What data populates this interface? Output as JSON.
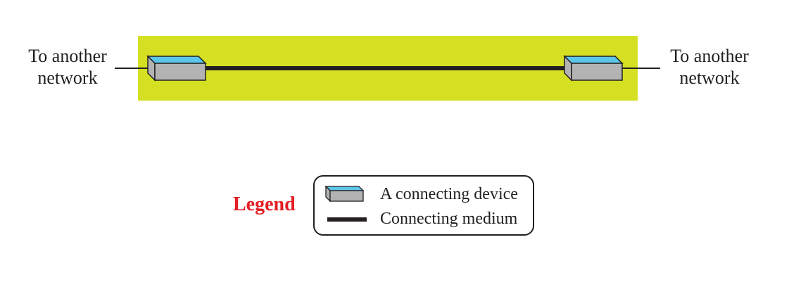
{
  "colors": {
    "network_area": "#d4e021",
    "device_top": "#5cc6ea",
    "device_body": "#b3b3b3",
    "medium": "#231f20",
    "text": "#231f20",
    "legend_title": "#e31e24"
  },
  "left_label": {
    "line1": "To another",
    "line2": "network"
  },
  "right_label": {
    "line1": "To another",
    "line2": "network"
  },
  "devices": [
    {
      "icon": "connecting-device-icon"
    },
    {
      "icon": "connecting-device-icon"
    }
  ],
  "legend": {
    "title": "Legend",
    "items": [
      {
        "icon": "connecting-device-icon",
        "label": "A connecting device"
      },
      {
        "icon": "connecting-medium-swatch",
        "label": "Connecting medium"
      }
    ]
  }
}
